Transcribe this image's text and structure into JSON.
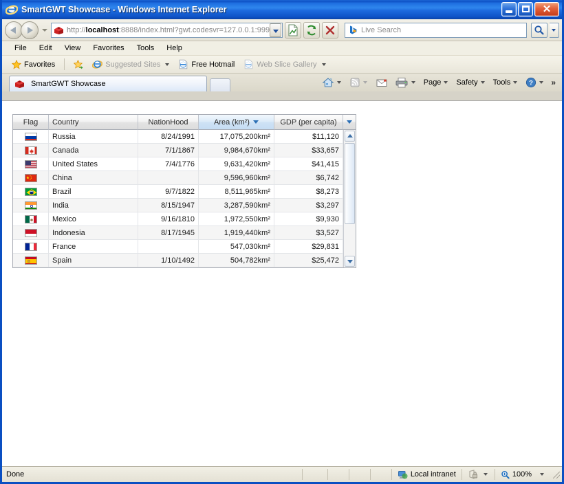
{
  "window": {
    "title": "SmartGWT Showcase - Windows Internet Explorer",
    "minimize_label": "Minimize",
    "maximize_label": "Maximize",
    "close_label": "✕"
  },
  "navbar": {
    "back_label": "Back",
    "forward_label": "Forward",
    "recent_pages_label": "Recent Pages",
    "url_prefix": "http://",
    "url_host": "localhost",
    "url_rest": ":8888/index.html?gwt.codesvr=127.0.0.1:999",
    "url_full": "http://localhost:8888/index.html?gwt.codesvr=127.0.0.1:999",
    "compatibility_label": "Compatibility View",
    "refresh_label": "Refresh",
    "stop_label": "Stop",
    "search_placeholder": "Live Search",
    "search_value": "",
    "search_go_label": "Search",
    "search_drop_label": "Search Options"
  },
  "menubar": {
    "items": [
      {
        "label": "File"
      },
      {
        "label": "Edit"
      },
      {
        "label": "View"
      },
      {
        "label": "Favorites"
      },
      {
        "label": "Tools"
      },
      {
        "label": "Help"
      }
    ]
  },
  "favbar": {
    "favorites_label": "Favorites",
    "items": [
      {
        "label": "Suggested Sites",
        "dim": true,
        "caret": true
      },
      {
        "label": "Free Hotmail",
        "dim": false,
        "caret": false
      },
      {
        "label": "Web Slice Gallery",
        "dim": true,
        "caret": true
      }
    ]
  },
  "tabs": {
    "active_tab_label": "SmartGWT Showcase",
    "new_tab_label": "New Tab"
  },
  "commandbar": {
    "home_label": "Home",
    "feeds_label": "Feeds",
    "mail_label": "Read Mail",
    "print_label": "Print",
    "page_label": "Page",
    "safety_label": "Safety",
    "tools_label": "Tools",
    "help_label": "Help",
    "overflow_label": "»"
  },
  "grid": {
    "columns": [
      {
        "key": "flag",
        "label": "Flag",
        "align": "center",
        "sorted": false
      },
      {
        "key": "country",
        "label": "Country",
        "align": "left",
        "sorted": false
      },
      {
        "key": "nation",
        "label": "NationHood",
        "align": "right",
        "sorted": false
      },
      {
        "key": "area",
        "label": "Area (km²)",
        "align": "right",
        "sorted": true
      },
      {
        "key": "gdp",
        "label": "GDP (per capita)",
        "align": "right",
        "sorted": false
      }
    ],
    "sort_column": "area",
    "sort_direction": "descending",
    "rows": [
      {
        "flag": "russia",
        "country": "Russia",
        "nation": "8/24/1991",
        "area": "17,075,200km²",
        "gdp": "$11,120"
      },
      {
        "flag": "canada",
        "country": "Canada",
        "nation": "7/1/1867",
        "area": "9,984,670km²",
        "gdp": "$33,657"
      },
      {
        "flag": "united-states",
        "country": "United States",
        "nation": "7/4/1776",
        "area": "9,631,420km²",
        "gdp": "$41,415"
      },
      {
        "flag": "china",
        "country": "China",
        "nation": "",
        "area": "9,596,960km²",
        "gdp": "$6,742"
      },
      {
        "flag": "brazil",
        "country": "Brazil",
        "nation": "9/7/1822",
        "area": "8,511,965km²",
        "gdp": "$8,273"
      },
      {
        "flag": "india",
        "country": "India",
        "nation": "8/15/1947",
        "area": "3,287,590km²",
        "gdp": "$3,297"
      },
      {
        "flag": "mexico",
        "country": "Mexico",
        "nation": "9/16/1810",
        "area": "1,972,550km²",
        "gdp": "$9,930"
      },
      {
        "flag": "indonesia",
        "country": "Indonesia",
        "nation": "8/17/1945",
        "area": "1,919,440km²",
        "gdp": "$3,527"
      },
      {
        "flag": "france",
        "country": "France",
        "nation": "",
        "area": "547,030km²",
        "gdp": "$29,831"
      },
      {
        "flag": "spain",
        "country": "Spain",
        "nation": "1/10/1492",
        "area": "504,782km²",
        "gdp": "$25,472"
      }
    ]
  },
  "statusbar": {
    "status": "Done",
    "zone": "Local intranet",
    "protected_mode_label": "Protected Mode",
    "zoom": "100%"
  },
  "colors": {
    "titlebar_blue": "#0a4fc2",
    "sorted_header": "#c5dcf3",
    "row_alt": "#f5f5f5",
    "chrome_beige": "#e9e6da"
  }
}
